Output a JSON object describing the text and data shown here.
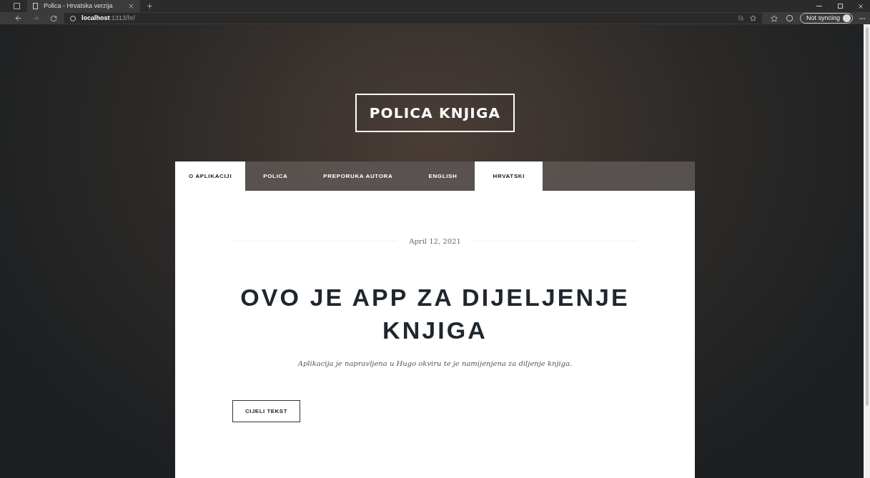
{
  "browser": {
    "tab_title": "Polica - Hrvatska verzija",
    "url_host": "localhost",
    "url_path": ":1313/hr/",
    "sync_label": "Not syncing"
  },
  "site": {
    "logo": "POLICA KNJIGA"
  },
  "nav": [
    {
      "label": "O APLIKACIJI",
      "selected": true
    },
    {
      "label": "POLICA",
      "selected": false
    },
    {
      "label": "PREPORUKA AUTORA",
      "selected": false
    },
    {
      "label": "ENGLISH",
      "selected": false
    },
    {
      "label": "HRVATSKI",
      "selected": true
    }
  ],
  "post": {
    "date": "April 12, 2021",
    "title": "OVO JE APP ZA DIJELJENJE KNJIGA",
    "excerpt": "Aplikacija je napravljena u Hugo okviru te je namijenjena za diljenje knjiga.",
    "button": "CIJELI TEKST"
  }
}
